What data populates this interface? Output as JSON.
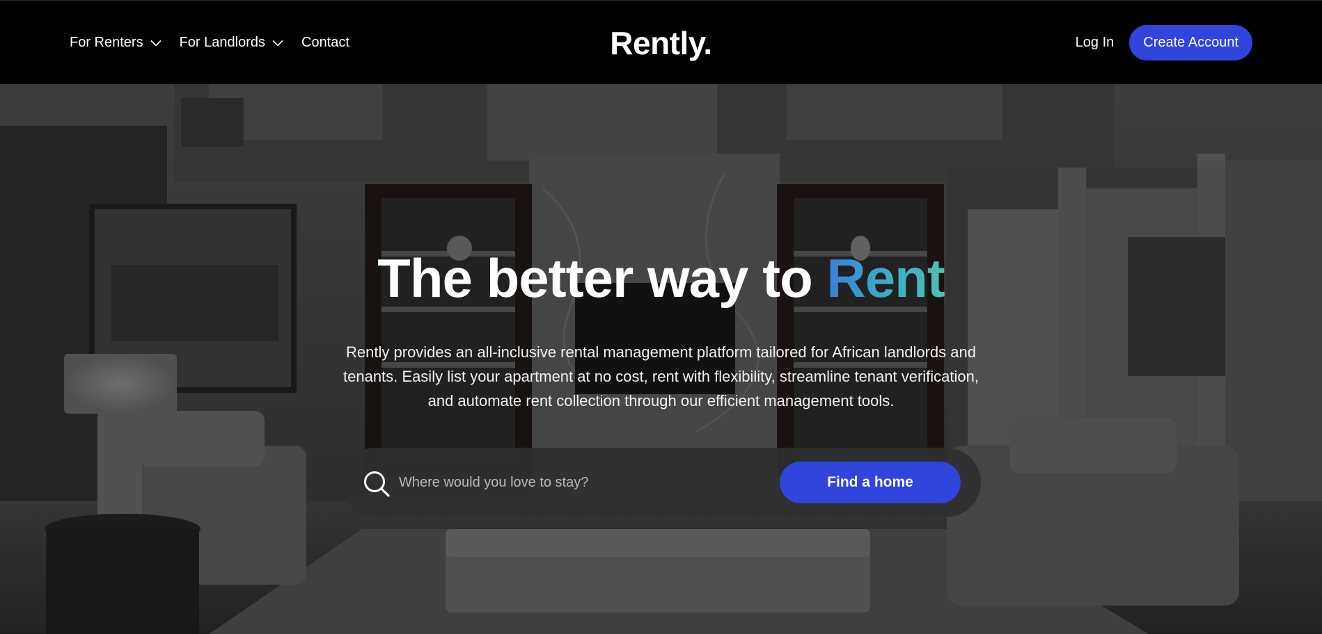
{
  "nav": {
    "for_renters": "For Renters",
    "for_landlords": "For Landlords",
    "contact": "Contact",
    "logo": "Rently.",
    "login": "Log In",
    "create_account": "Create Account"
  },
  "hero": {
    "title_prefix": "The better way to",
    "title_accent": "Rent",
    "description": "Rently provides an all-inclusive rental management platform tailored for African landlords and tenants. Easily list your apartment at no cost, rent with flexibility, streamline tenant verification, and automate rent collection through our efficient management tools.",
    "search_placeholder": "Where would you love to stay?",
    "search_value": "",
    "find_button": "Find a home"
  },
  "icons": {
    "chevron": "chevron-down-icon",
    "search": "search-icon"
  },
  "colors": {
    "nav_background": "#000000",
    "primary_button": "#2f45dc",
    "accent_gradient_start": "#3b7fd6",
    "accent_gradient_end": "#4dc0b0"
  }
}
